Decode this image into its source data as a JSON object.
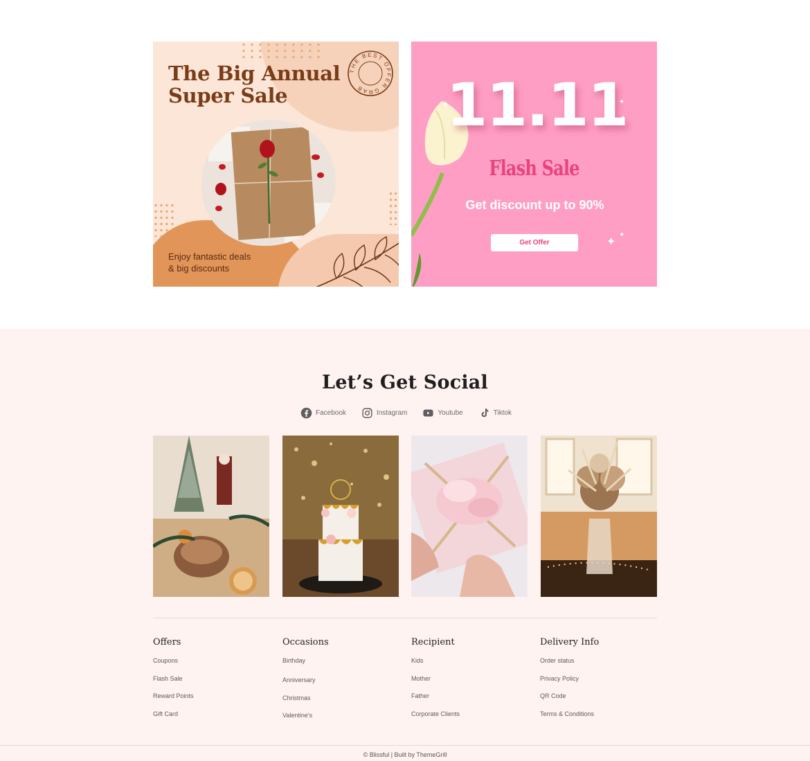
{
  "promo": {
    "annual": {
      "title": "The Big Annual Super Sale",
      "stamp_text": "THE BEST OFFER GRAB",
      "copy_line1": "Enjoy fantastic deals",
      "copy_line2": "& big discounts",
      "colors": {
        "bg": "#fce6d7",
        "title": "#7a3c18",
        "accent": "#e29558"
      }
    },
    "flash": {
      "number": "11.11",
      "subtitle": "Flash Sale",
      "discount": "Get discount up to 90%",
      "button_label": "Get Offer",
      "colors": {
        "bg": "#ff9ec4",
        "accent": "#e8437c"
      }
    }
  },
  "social": {
    "title": "Let’s Get Social",
    "links": [
      {
        "label": "Facebook",
        "icon": "facebook-icon"
      },
      {
        "label": "Instagram",
        "icon": "instagram-icon"
      },
      {
        "label": "Youtube",
        "icon": "youtube-icon"
      },
      {
        "label": "Tiktok",
        "icon": "tiktok-icon"
      }
    ],
    "gallery": [
      {
        "subject": "christmas-table-photo"
      },
      {
        "subject": "wedding-cake-photo"
      },
      {
        "subject": "gift-box-photo"
      },
      {
        "subject": "dried-flowers-photo"
      }
    ]
  },
  "footer": {
    "columns": [
      {
        "heading": "Offers",
        "links": [
          "Coupons",
          "Flash Sale",
          "Reward Points",
          "Gift Card"
        ]
      },
      {
        "heading": "Occasions",
        "links": [
          "Birthday",
          "Anniversary",
          "Christmas",
          "Valentine's"
        ]
      },
      {
        "heading": "Recipient",
        "links": [
          "Kids",
          "Mother",
          "Father",
          "Corporate Clients"
        ]
      },
      {
        "heading": "Delivery Info",
        "links": [
          "Order status",
          "Privacy Policy",
          "QR Code",
          "Terms & Conditions"
        ]
      }
    ],
    "copyright": "© Blissful | Built by ThemeGrill",
    "background": "#fff3f1"
  }
}
